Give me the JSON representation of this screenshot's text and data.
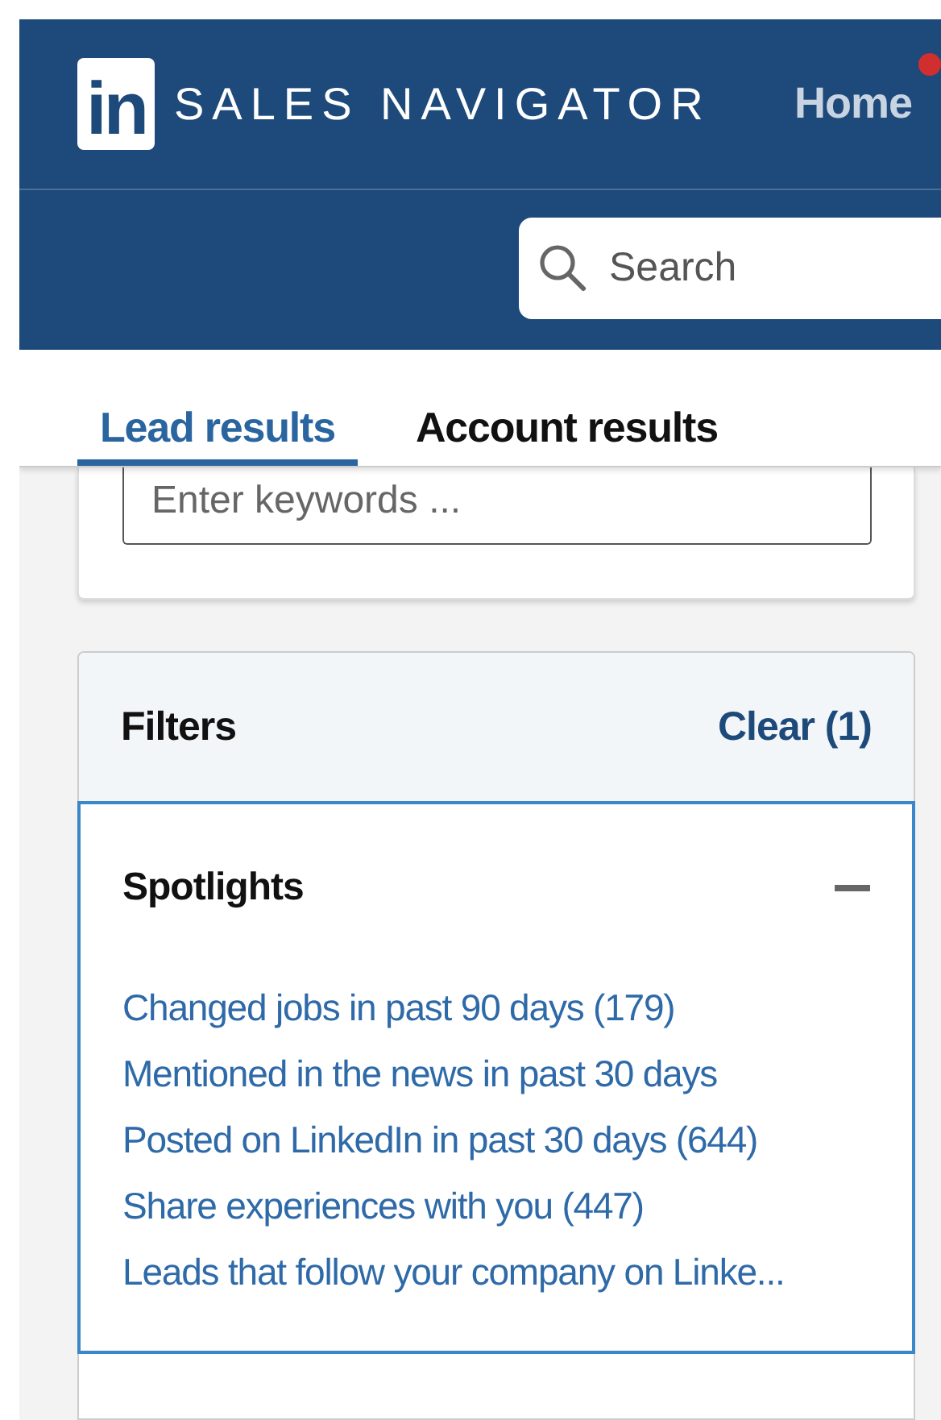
{
  "header": {
    "logo_text": "in",
    "brand": "SALES NAVIGATOR",
    "nav": [
      {
        "label": "Home",
        "notification": true
      }
    ],
    "search": {
      "placeholder": "Search"
    }
  },
  "tabs": [
    {
      "label": "Lead results",
      "selected": true
    },
    {
      "label": "Account results",
      "selected": false
    }
  ],
  "keywords": {
    "placeholder": "Enter keywords ..."
  },
  "filters": {
    "title": "Filters",
    "clear": "Clear (1)",
    "sections": [
      {
        "title": "Spotlights",
        "expanded": true,
        "items": [
          "Changed jobs in past 90 days (179)",
          "Mentioned in the news in past 30 days",
          "Posted on LinkedIn in past 30 days (644)",
          "Share experiences with you (447)",
          "Leads that follow your company on Linke..."
        ]
      }
    ]
  }
}
